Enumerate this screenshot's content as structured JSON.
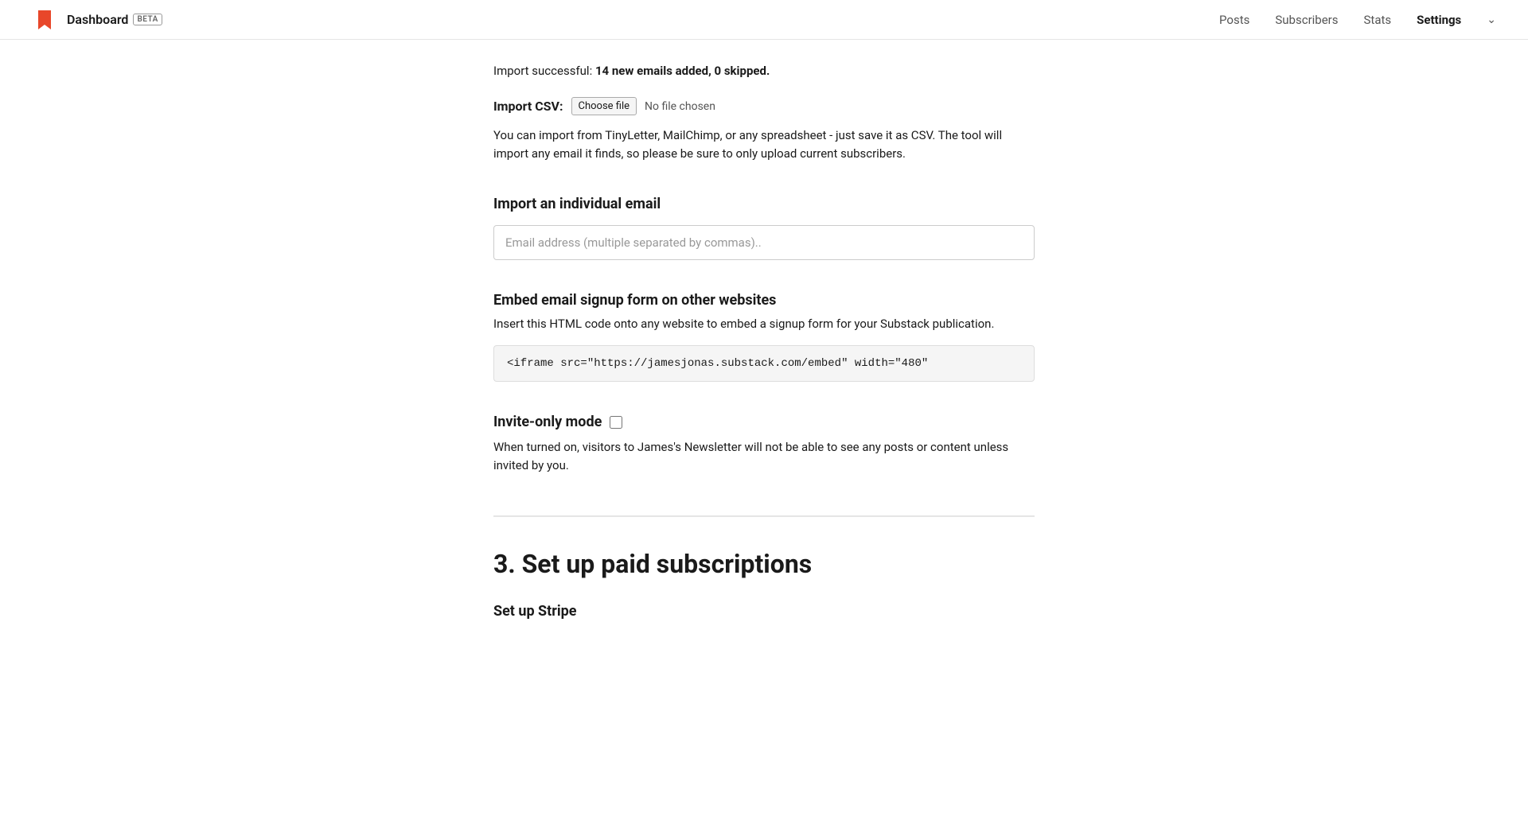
{
  "header": {
    "brand": "Dashboard",
    "beta_badge": "BETA",
    "nav": {
      "posts_label": "Posts",
      "subscribers_label": "Subscribers",
      "stats_label": "Stats",
      "settings_label": "Settings"
    }
  },
  "import_success": {
    "message_prefix": "Import successful: ",
    "message_bold": "14 new emails added, 0 skipped.",
    "full_text": "Import successful: 14 new emails added, 0 skipped."
  },
  "import_csv": {
    "label": "Import CSV:",
    "button_label": "Choose file",
    "no_file_text": "No file chosen",
    "description": "You can import from TinyLetter, MailChimp, or any spreadsheet - just save it as CSV. The tool will import any email it finds, so please be sure to only upload current subscribers."
  },
  "import_individual": {
    "title": "Import an individual email",
    "placeholder": "Email address (multiple separated by commas).."
  },
  "embed_section": {
    "title": "Embed email signup form on other websites",
    "description": "Insert this HTML code onto any website to embed a signup form for your Substack publication.",
    "code": "<iframe src=\"https://jamesjonas.substack.com/embed\" width=\"480\""
  },
  "invite_only": {
    "title": "Invite-only mode",
    "description": "When turned on, visitors to James's Newsletter will not be able to see any posts or content unless invited by you.",
    "checked": false
  },
  "section3": {
    "title": "3. Set up paid subscriptions",
    "setup_stripe_title": "Set up Stripe"
  }
}
